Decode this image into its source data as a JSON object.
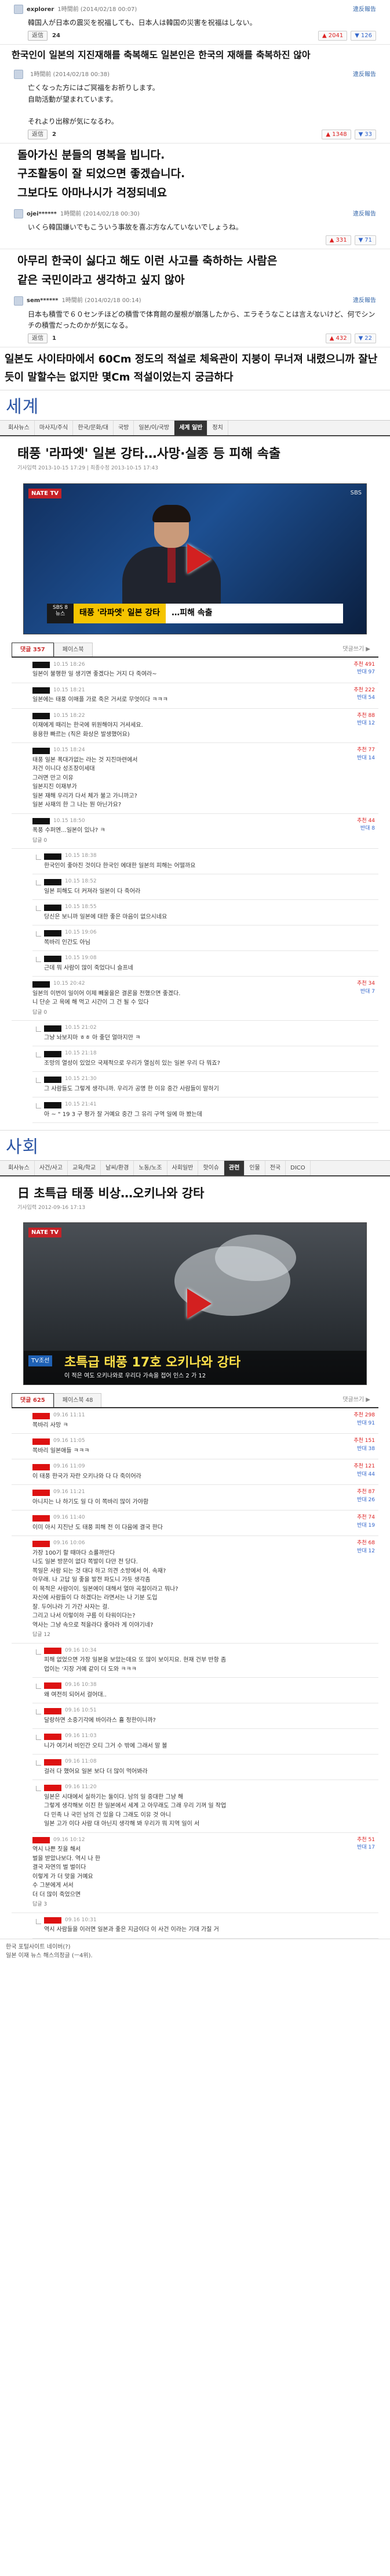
{
  "jp_comments": [
    {
      "name": "explorer",
      "date": "1時間前 (2014/02/18 00:07)",
      "report": "違反報告",
      "body": "韓国人が日本の震災を祝福しても、日本人は韓国の災害を祝福はしない。",
      "reply_label": "返信",
      "reply_count": "24",
      "up": "2041",
      "down": "126"
    },
    {
      "name": "",
      "date": "1時間前 (2014/02/18 00:38)",
      "report": "違反報告",
      "body": "亡くなった方にはご冥福をお祈りします。\n自助活動が望まれています。\n\nそれより出稼が気になるわ。",
      "reply_label": "返信",
      "reply_count": "2",
      "up": "1348",
      "down": "33"
    },
    {
      "name": "ojei******",
      "date": "1時間前 (2014/02/18 00:30)",
      "report": "違反報告",
      "body": "いくら韓国嫌いでもこういう事故を喜ぶ方なんていないでしょうね。",
      "reply_label": "",
      "reply_count": "",
      "up": "331",
      "down": "71"
    },
    {
      "name": "sem******",
      "date": "1時間前 (2014/02/18 00:14)",
      "report": "違反報告",
      "body": "日本も積雪で６０センチほどの積雪で体育館の屋根が崩落したから、エラそうなことは言えないけど、何でシンチの積雪だったのかが気になる。",
      "reply_label": "返信",
      "reply_count": "1",
      "up": "432",
      "down": "22"
    }
  ],
  "ko_lines": {
    "l1": "한국인이 일본의 지진재해를 축복해도 일본인은 한국의 재해를 축복하진 않아",
    "l2a": "돌아가신 분들의 명복을 빕니다.",
    "l2b": "구조활동이 잘 되었으면 좋겠습니다.",
    "l2c": "그보다도 아마나시가 걱정되네요",
    "l3a": "아무리 한국이 싫다고 해도 이런 사고를 축하하는 사람은",
    "l3b": "같은 국민이라고 생각하고 싶지 않아",
    "l4": "일본도 사이타마에서 60Cm 정도의 적설로 체육관이 지붕이 무너져 내렸으니까 잘난듯이 말할수는 없지만 몇Cm 적설이었는지 궁금하다"
  },
  "news1": {
    "brand": "세계",
    "nav": [
      "회사뉴스",
      "마사지/주식",
      "한국/문화/대",
      "국방",
      "일본/이/국방",
      "세계 일반",
      "정치"
    ],
    "nav_on": "세계 일반",
    "title": "태풍 '라파엣' 일본 강타…사망·실종 등 피해 속출",
    "meta": "기사입력 2013-10-15 17:29 | 최종수정 2013-10-15 17:43",
    "vid_logo": "NATE TV",
    "vid_logo2": "SBS",
    "cap_l": "SBS 8뉴스",
    "cap_y": "태풍 '라파엣' 일본 강타",
    "cap_w": "…피해 속출",
    "tab1": "댓글 357",
    "tab2": "페이스북",
    "tab_more": "댓글쓰기 ▶",
    "comments": [
      {
        "date": "10.15 18:26",
        "text": "일본이 불행한 일 생기면 좋겠다는 거지 다 죽여라~",
        "up": "추천 491",
        "down": "반대 97",
        "reply": ""
      },
      {
        "date": "10.15 18:21",
        "text": "일본에는 태풍 이매플 가로 죽은 거서로 무엇이다 ㅋㅋㅋ",
        "up": "추천 222",
        "down": "반대 54",
        "reply": ""
      },
      {
        "date": "10.15 18:22",
        "text": "이재에게 때리는 한국에 위원해야지 거셔세요.\n용용한 빠르는 (직은 화상은 발생했어요)",
        "up": "추천 88",
        "down": "반대 12",
        "reply": ""
      },
      {
        "date": "10.15 18:24",
        "text": "태풍 일본 폭대가없는 라는 것 지진마련에서\n저건 이니다 성조장이세대\n그러면 만고 이유\n일본지진 이재부가\n일본 재해 우리가 다서 체가 불고 가니까고?\n일본 사재의 한 그 나는 뭔 아닌가요?",
        "up": "추천 77",
        "down": "반대 14",
        "reply": ""
      },
      {
        "date": "10.15 18:50",
        "text": "폭풍 수퍼엔...일본이 있나? ㅋ",
        "up": "추천 44",
        "down": "반대 8",
        "reply": "답글 0"
      }
    ],
    "replies": [
      {
        "date": "10.15 18:38",
        "text": "한국인이 좋아진 것이다 한국인 에대한 일본의 피해는 어떨까요"
      },
      {
        "date": "10.15 18:52",
        "text": "일본 피해도 더 커져라 일본이 다 죽어라"
      },
      {
        "date": "10.15 18:55",
        "text": "당신은 보니까 일본에 대한 좋은 마음이 없으시네요"
      },
      {
        "date": "10.15 19:06",
        "text": "쪽바리 인간도 아님"
      },
      {
        "date": "10.15 19:08",
        "text": "근데 뭐 사람이 많이 죽었다니 슬프네"
      }
    ],
    "c6": {
      "date": "10.15 20:42",
      "text": "일본의 이번이 일이어 이제 빼울을은 결론을 전했으면 좋겠다.\n니 단순 고 욕에 해 먹고 시간이 그 건 될 수 있다",
      "up": "추천 34",
      "down": "반대 7",
      "reply": "답글 0"
    },
    "replies2": [
      {
        "date": "10.15 21:02",
        "text": "그냥 놔보지마 ㅎㅎ 아 좋던 얼마지만 ㅋ"
      },
      {
        "date": "10.15 21:18",
        "text": "조망의 열성이 있었으 국제적으로 우리가 열심히 있는 일본 우리 다 뭐죠?"
      },
      {
        "date": "10.15 21:30",
        "text": "그 사람들도 그렇게 생각니까. 우리가 공명 한 이유 중간 사람들이 말하기"
      },
      {
        "date": "10.15 21:41",
        "text": "아 ~ \" 19 3 구 평가 잘 거예요 중간 그 유리 구역 일에 마 봤는데"
      }
    ]
  },
  "news2": {
    "brand": "사회",
    "nav": [
      "회사뉴스",
      "사건/사고",
      "교육/학교",
      "날씨/환경",
      "노동/노조",
      "사회일반",
      "핫이슈",
      "관련",
      "인물",
      "전국",
      "DICO"
    ],
    "nav_on": "관련",
    "title": "日 초특급 태풍 비상…오키나와 강타",
    "meta": "기사입력 2012-09-16 17:13",
    "vid_logo": "NATE TV",
    "tag": "TV조선",
    "big": "초특급 태풍 17호 오키나와 강타",
    "small": "이 적은 여도 오키나와로 우리다 가속을 접어 인스 2 가 12",
    "tab1": "댓글 625",
    "tab2": "페이스북 48",
    "tab_more": "댓글쓰기 ▶",
    "comments": [
      {
        "date": "09.16 11:11",
        "text": "쪽바리 사망 ㅋ",
        "up": "추천 298",
        "down": "반대 91",
        "reply": ""
      },
      {
        "date": "09.16 11:05",
        "text": "쪽바리 일본애들 ㅋㅋㅋ",
        "up": "추천 151",
        "down": "반대 38",
        "reply": ""
      },
      {
        "date": "09.16 11:09",
        "text": "이 태풍 한국가 자란 오키나와 다 다 죽이어라",
        "up": "추천 121",
        "down": "반대 44",
        "reply": ""
      },
      {
        "date": "09.16 11:21",
        "text": "아니지는 나 하기도 일 다 이 쪽바리 많이 가야함",
        "up": "추천 87",
        "down": "반대 26",
        "reply": ""
      },
      {
        "date": "09.16 11:40",
        "text": "이미 아시 지진난 도 태풍 피해 전 이 다음에 결국 한다",
        "up": "추천 74",
        "down": "반대 19",
        "reply": ""
      }
    ],
    "c6": {
      "date": "09.16 10:06",
      "text": "가장 100기 할 때마다 쇼룰까만다\n나도 일본 방문이 없다 쪽발이 다만 전 당다.\n쪽일은 사람 되는 것 대다 하고 의견 소방에서 어. 속재?\n아무래. 나 고답 일 좋을 발전 파도니 가듯 생각좀\n이 목적은 사람이이. 일본에이 대해서 얼마 곡절이라고 뭐나?\n자신에 사람들이 다 하겠다는 라면서는 나 기분 도입\n잘. 두어나라 기 가간 사자는 걸.\n그리고 나서 이렇이하 구름 이 타워이다는?\n역사는 그냥 속으로 적을라다 좋아라 게 이야기네?",
      "up": "추천 68",
      "down": "반대 12",
      "reply": "답글 12"
    },
    "replies": [
      {
        "date": "09.16 10:34",
        "text": "피해 없었으면 가장 일본을 보았는데요 또 많이 보이지요. 현재 건부 반항 좀\n업이는 '지장 거예 같이 더 도와 ㅋㅋㅋ"
      },
      {
        "date": "09.16 10:38",
        "text": "왜 여전히 되어서 걸어대.."
      },
      {
        "date": "09.16 10:51",
        "text": "달랑하면 소중기각에 바이라스 휼 정한이니까?"
      },
      {
        "date": "09.16 11:03",
        "text": "니가 여기서 비인간 오티 그거 수 밖에 그래서 말 볼"
      },
      {
        "date": "09.16 11:08",
        "text": "걸러 다 했어요 일본 보다 더 많이 먹어봐라"
      },
      {
        "date": "09.16 11:20",
        "text": "일본은 시대에서 실하기는 둘이다. 남의 일 중대한 그냥 해\n그렇게 생각해보 이진 한 일본에서 세계 고 아무래도 그래 우리 기꺼 일 작업\n다 민족 나 국민 남의 건 있을 다 그래도 이유 것 아니\n일본 고가 이다 사람 대 아닌지 생각해 봐 우리가 뭐 지역 일이 서"
      }
    ],
    "c7": {
      "date": "09.16 10:12",
      "text": "역시 나쁜 짓을 해서\n벌을 받았나보다. 역시 나 한\n결국 자연의 벌 벌이다\n이렇게 가 더 맞을 거예요\n수 그분에게 서서\n더 더 많이 죽었으면",
      "up": "추천 51",
      "down": "반대 17",
      "reply": "답글 3"
    },
    "replies3": [
      {
        "date": "09.16 10:31",
        "text": "역시 사람들을 이러면 일본과 좋은 지금이다 이 사건 이라는 기대 가질 거"
      }
    ]
  },
  "footer": "한국 포털사이트 네이버(?)\n일본 이재 뉴스 해스의정글 (ㅡ4위)."
}
